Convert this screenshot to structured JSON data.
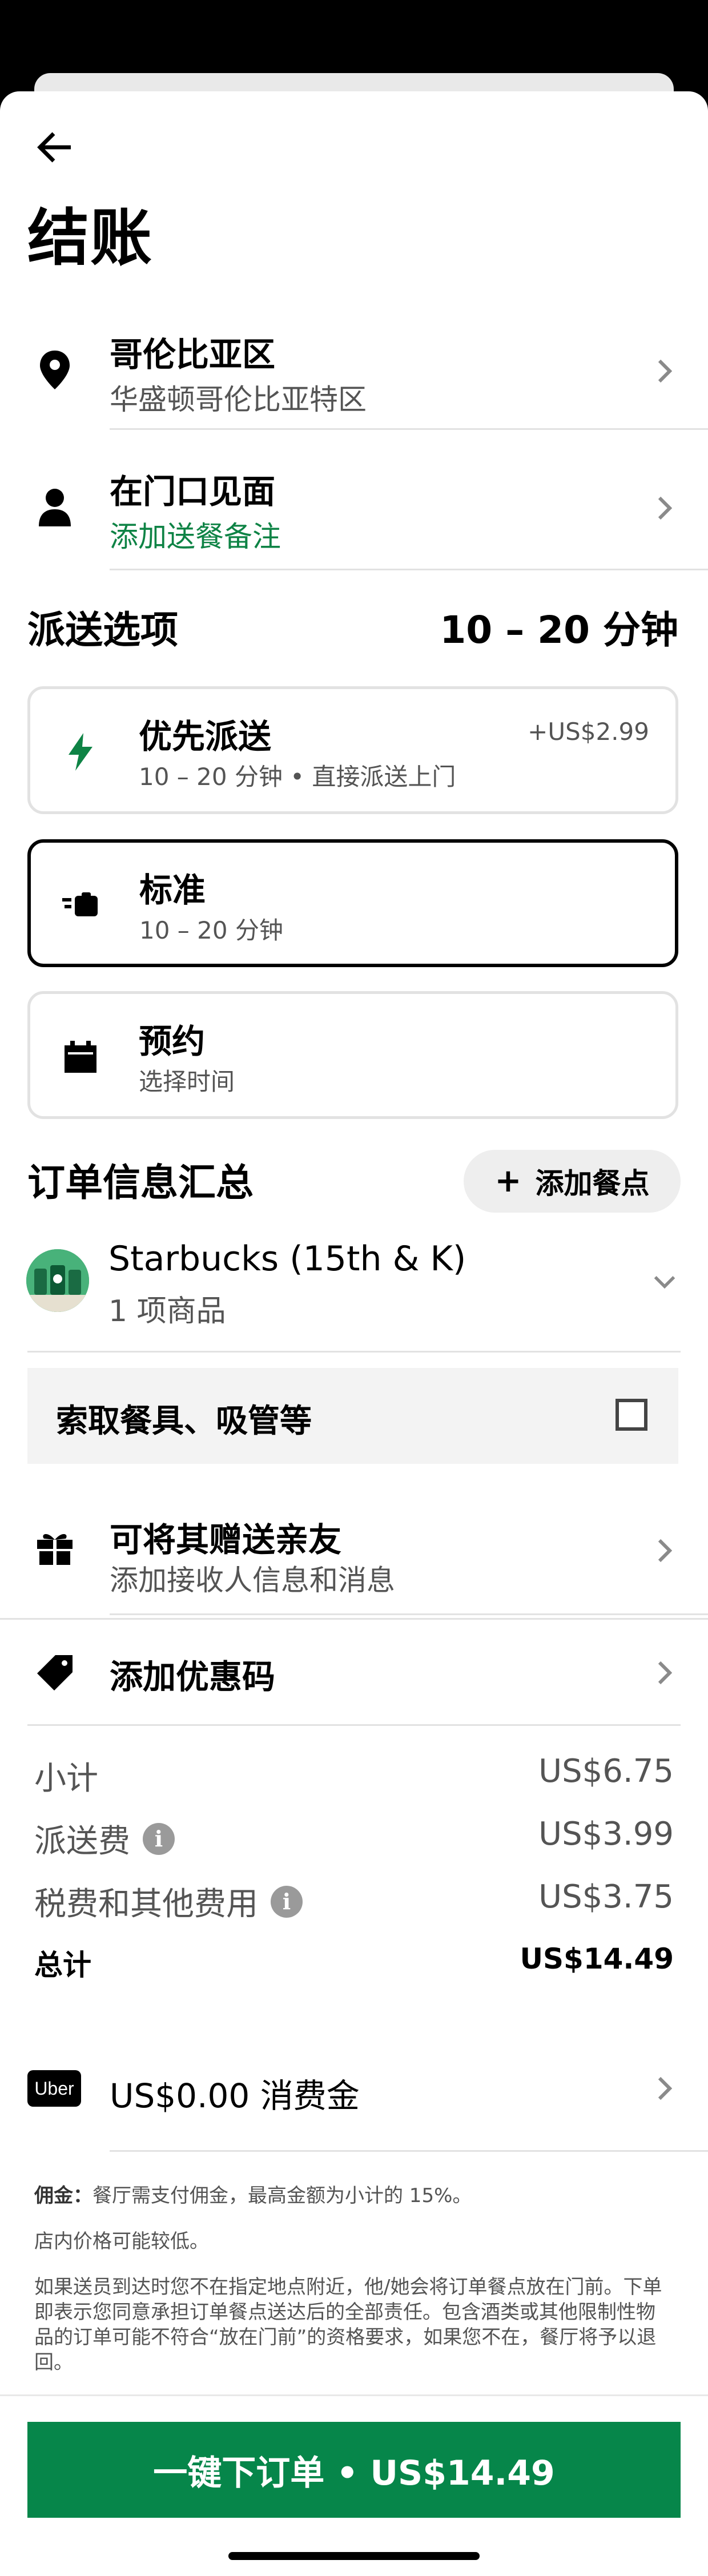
{
  "header": {
    "title": "结账"
  },
  "address": {
    "title": "哥伦比亚区",
    "subtitle": "华盛顿哥伦比亚特区"
  },
  "dropoff": {
    "title": "在门口见面",
    "subtitle": "添加送餐备注"
  },
  "delivery": {
    "section_title": "派送选项",
    "eta": "10 – 20 分钟",
    "options": [
      {
        "title": "优先派送",
        "subtitle": "10 – 20 分钟 • 直接派送上门",
        "price": "+US$2.99",
        "icon": "lightning-icon",
        "selected": false
      },
      {
        "title": "标准",
        "subtitle": "10 – 20 分钟",
        "price": "",
        "icon": "delivery-icon",
        "selected": true
      },
      {
        "title": "预约",
        "subtitle": "选择时间",
        "price": "",
        "icon": "calendar-icon",
        "selected": false
      }
    ]
  },
  "summary": {
    "section_title": "订单信息汇总",
    "add_items_label": "添加餐点",
    "store_name": "Starbucks (15th & K)",
    "item_count": "1 项商品",
    "utensils_label": "索取餐具、吸管等"
  },
  "gift": {
    "title": "可将其赠送亲友",
    "subtitle": "添加接收人信息和消息"
  },
  "promo": {
    "label": "添加优惠码"
  },
  "fees": {
    "subtotal_label": "小计",
    "subtotal_value": "US$6.75",
    "delivery_label": "派送费",
    "delivery_value": "US$3.99",
    "tax_label": "税费和其他费用",
    "tax_value": "US$3.75",
    "total_label": "总计",
    "total_value": "US$14.49"
  },
  "credits": {
    "badge": "Uber",
    "label": "US$0.00 消费金"
  },
  "fine_print": {
    "commission_label": "佣金：",
    "commission_text": "餐厅需支付佣金，最高金额为小计的 15%。",
    "price_note": "店内价格可能较低。",
    "leave_at_door": "如果送员到达时您不在指定地点附近，他/她会将订单餐点放在门前。下单即表示您同意承担订单餐点送达后的全部责任。包含酒类或其他限制性物品的订单可能不符合“放在门前”的资格要求，如果您不在，餐厅将予以退回。"
  },
  "footer": {
    "place_order_label": "一键下订单 • US$14.49"
  },
  "colors": {
    "brand_green": "#06864a",
    "link_green": "#0e8345"
  }
}
